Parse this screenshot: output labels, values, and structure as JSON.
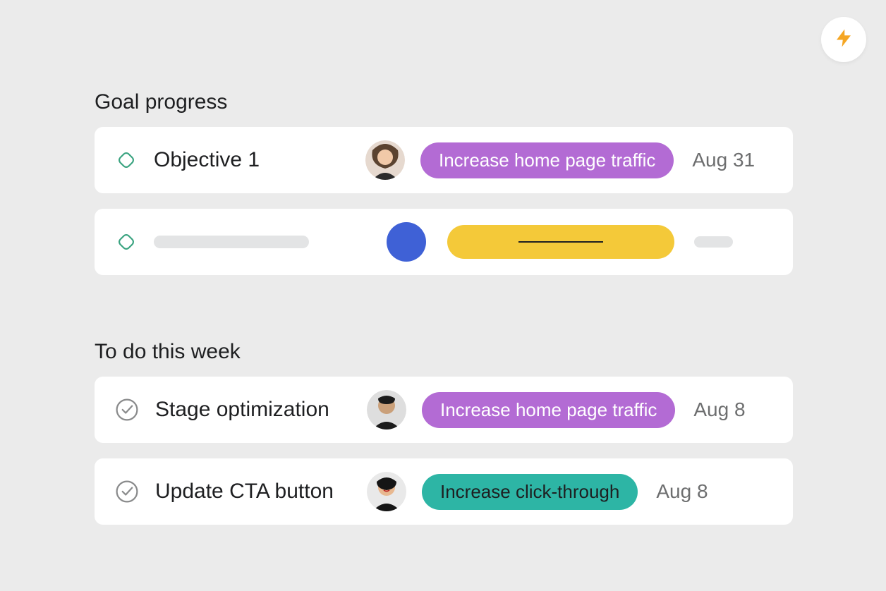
{
  "fab": {
    "icon": "lightning-icon",
    "color": "#f5a623"
  },
  "sections": {
    "goal_progress": {
      "title": "Goal progress",
      "items": [
        {
          "icon": "diamond",
          "title": "Objective 1",
          "avatar": "person-1",
          "tag": {
            "label": "Increase home page traffic",
            "style": "purple"
          },
          "date": "Aug 31"
        },
        {
          "icon": "diamond",
          "title": null,
          "avatar": "placeholder-blue",
          "tag": {
            "label": null,
            "style": "yellow-skeleton"
          },
          "date": null,
          "skeleton": true
        }
      ]
    },
    "todo_week": {
      "title": "To do this week",
      "items": [
        {
          "icon": "check-circle",
          "title": "Stage optimization",
          "avatar": "person-2",
          "tag": {
            "label": "Increase home page traffic",
            "style": "purple"
          },
          "date": "Aug 8"
        },
        {
          "icon": "check-circle",
          "title": "Update CTA button",
          "avatar": "person-3",
          "tag": {
            "label": "Increase click-through",
            "style": "teal"
          },
          "date": "Aug 8"
        }
      ]
    }
  },
  "colors": {
    "purple": "#b36bd4",
    "teal": "#2db5a5",
    "yellow": "#f4c939",
    "blue": "#3f61d6",
    "diamond_stroke": "#3aa380",
    "check_stroke": "#8a8b8c"
  }
}
